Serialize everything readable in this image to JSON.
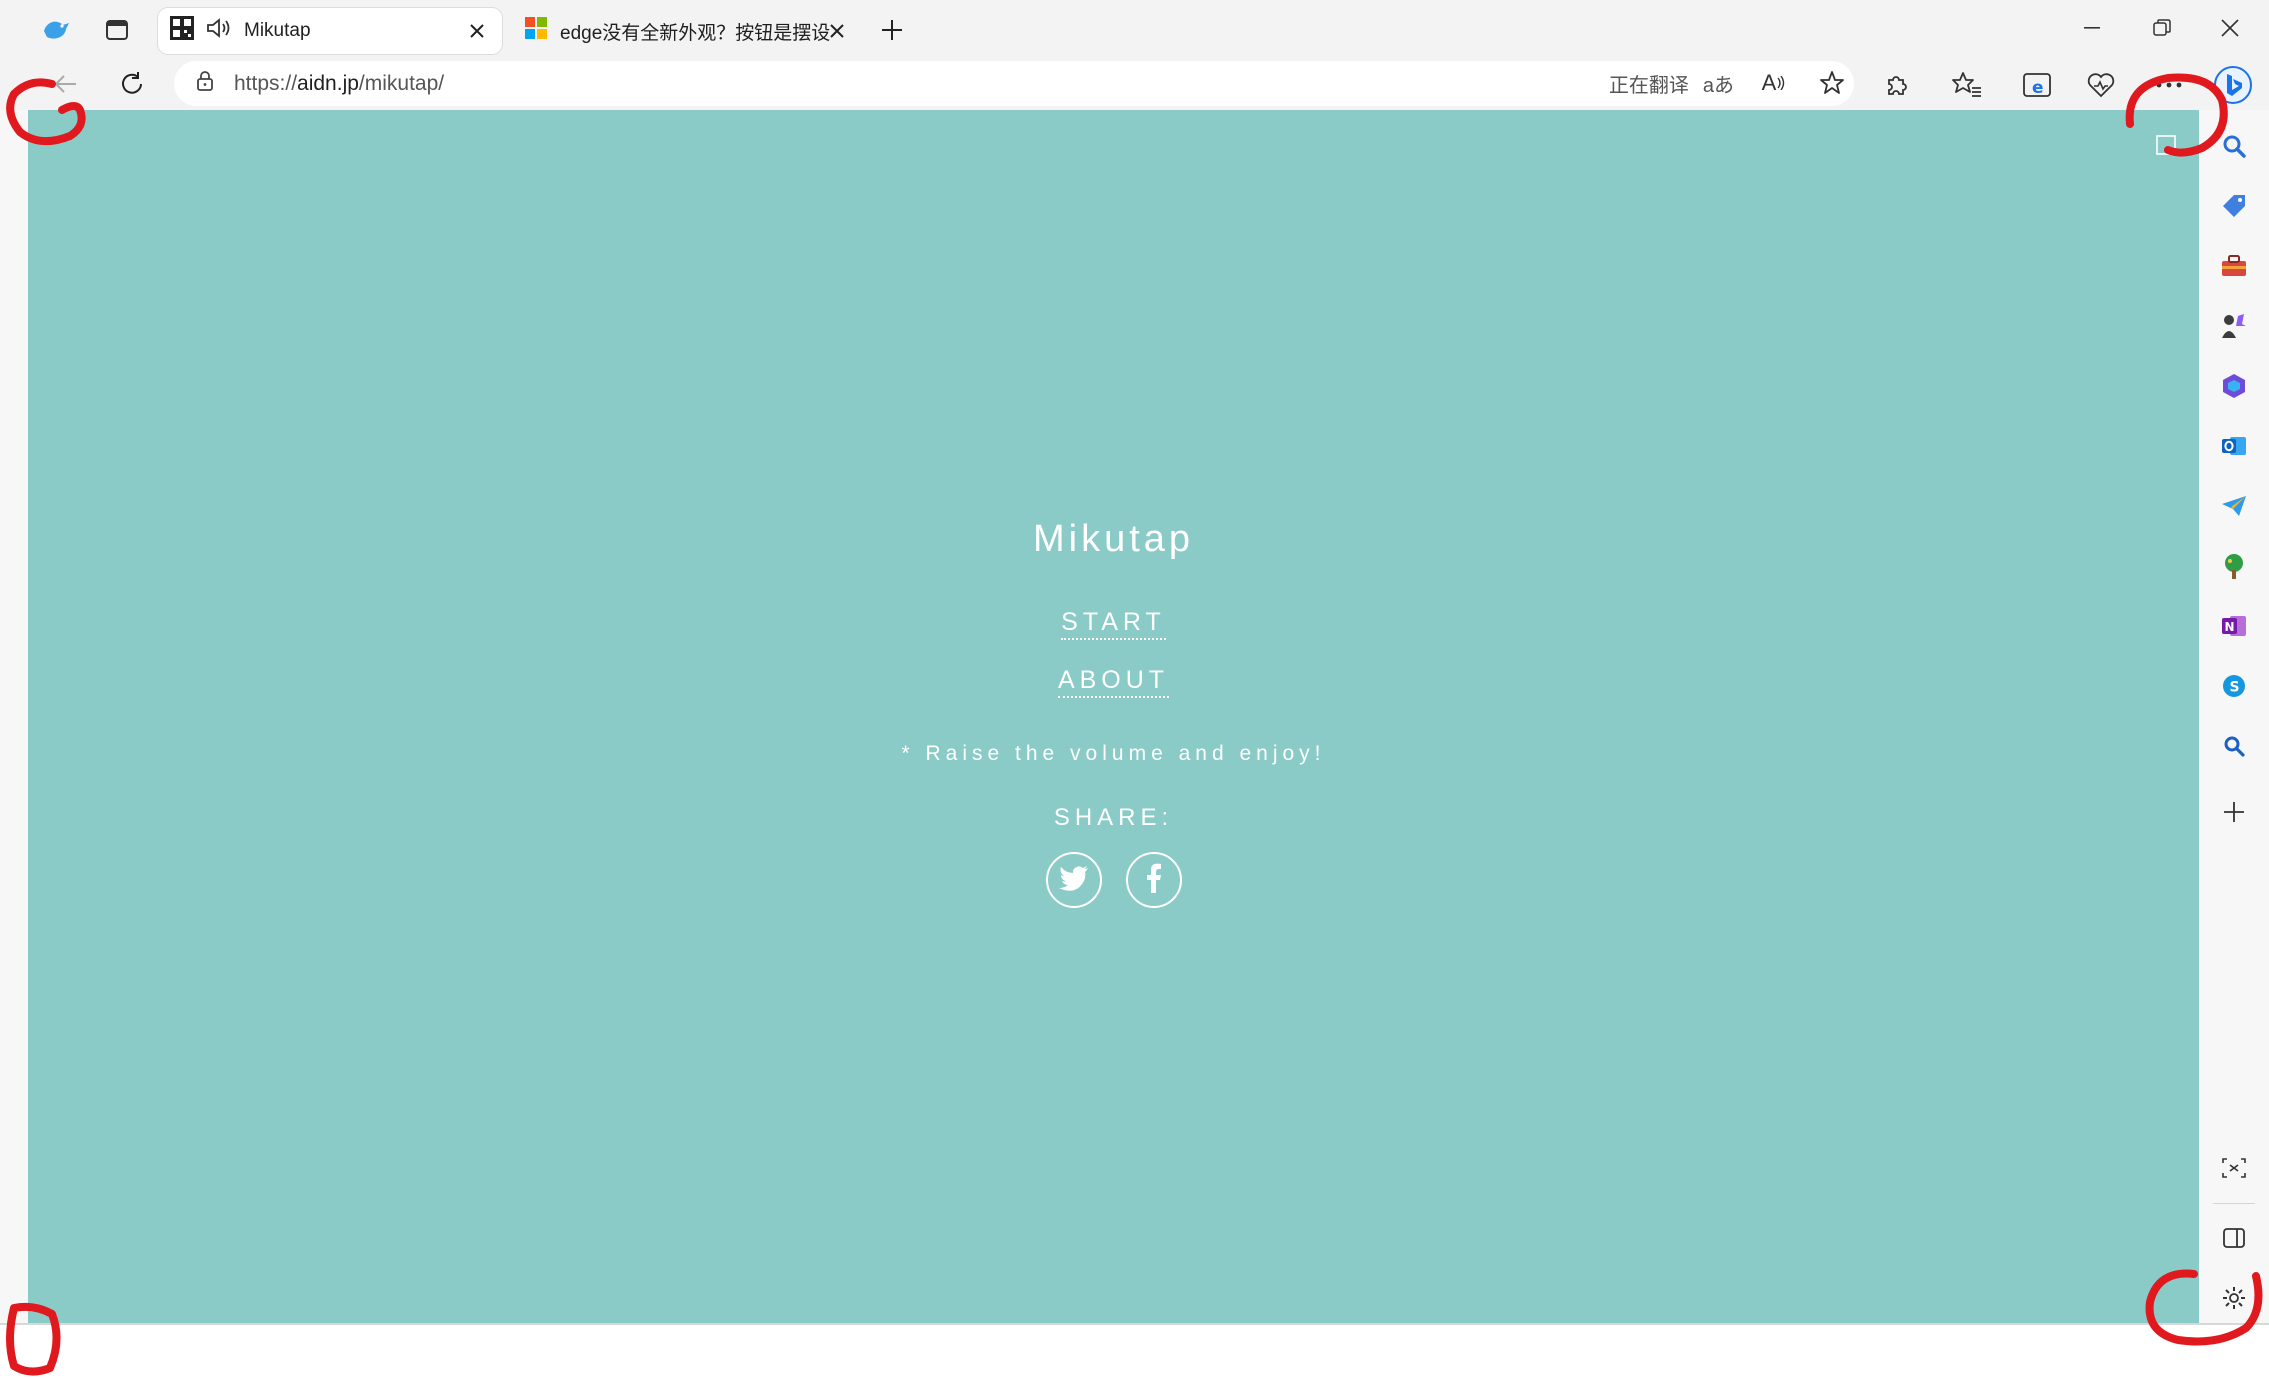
{
  "tabs": [
    {
      "label": "Mikutap",
      "favicon": "aidn-qr-favicon",
      "audio": "speaker-icon",
      "active": true
    },
    {
      "label": "edge没有全新外观？按钮是摆设",
      "favicon": "microsoft-logo",
      "active": false
    }
  ],
  "toolbar": {
    "url_scheme": "https://",
    "url_host": "aidn.jp",
    "url_path": "/mikutap/",
    "translating_label": "正在翻译",
    "translate_glyph": "aあ",
    "read_aloud_glyph": "A"
  },
  "page": {
    "title": "Mikutap",
    "start_link": "START",
    "about_link": "ABOUT",
    "notice": "* Raise the volume and enjoy!",
    "share_label": "SHARE:",
    "background_color": "#8acbc8"
  },
  "sidebar_items": [
    "search-icon",
    "shopping-tag-icon",
    "tools-briefcase-icon",
    "games-icon",
    "microsoft-365-icon",
    "outlook-icon",
    "telegram-send-icon",
    "tree-icon",
    "onenote-icon",
    "skype-icon",
    "search-blue-icon",
    "add-icon"
  ],
  "colors": {
    "annotation_red": "#e0191e",
    "accent_blue": "#1a73e8"
  }
}
